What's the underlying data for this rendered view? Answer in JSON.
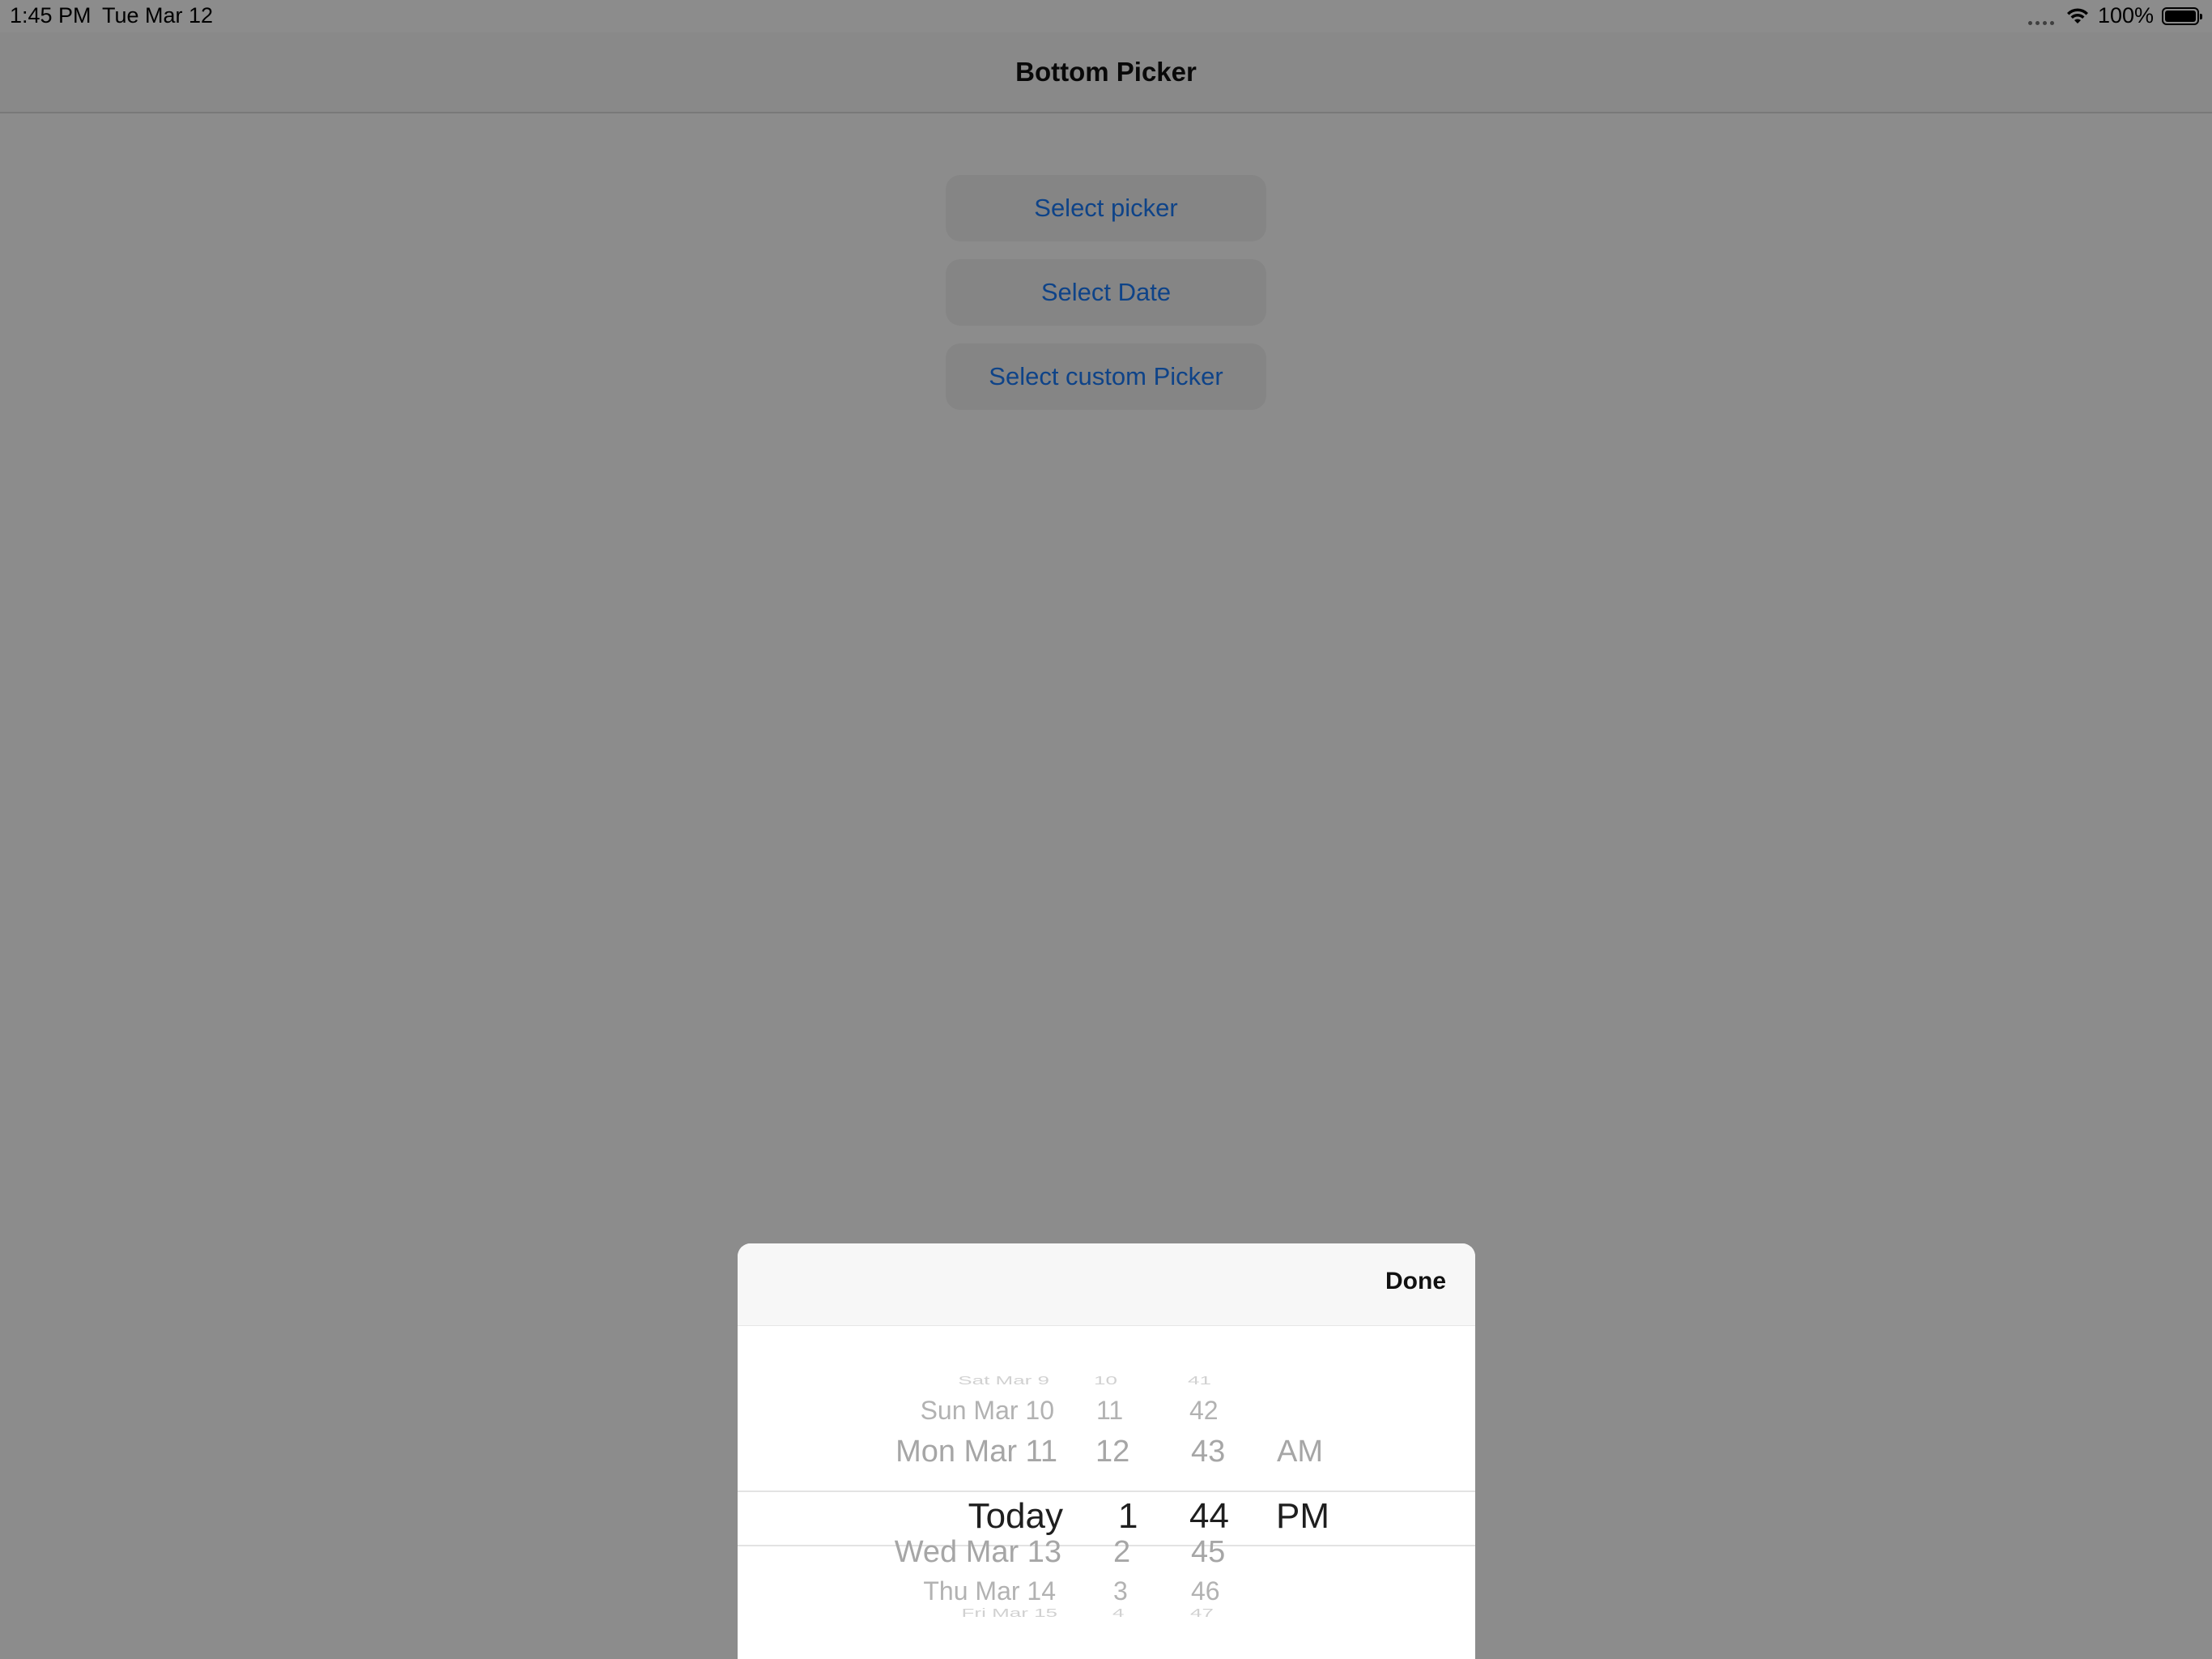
{
  "status_bar": {
    "time": "1:45 PM",
    "date": "Tue Mar 12",
    "battery": "100%",
    "wifi_icon": "wifi-icon",
    "battery_icon": "battery-icon"
  },
  "nav": {
    "title": "Bottom Picker"
  },
  "buttons": {
    "select_picker": "Select picker",
    "select_date": "Select Date",
    "select_custom_picker": "Select custom Picker"
  },
  "sheet": {
    "done_label": "Done",
    "picker": {
      "dates": [
        "Sat Mar 9",
        "Sun Mar 10",
        "Mon Mar 11",
        "Today",
        "Wed Mar 13",
        "Thu Mar 14",
        "Fri Mar 15"
      ],
      "hours": [
        "10",
        "11",
        "12",
        "1",
        "2",
        "3",
        "4"
      ],
      "minutes": [
        "41",
        "42",
        "43",
        "44",
        "45",
        "46",
        "47"
      ],
      "periods": [
        "AM",
        "PM"
      ],
      "selected": {
        "date": "Today",
        "hour": "1",
        "minute": "44",
        "period": "PM"
      }
    }
  },
  "colors": {
    "accent": "#1a7af8",
    "overlay": "rgba(0,0,0,0.45)"
  }
}
